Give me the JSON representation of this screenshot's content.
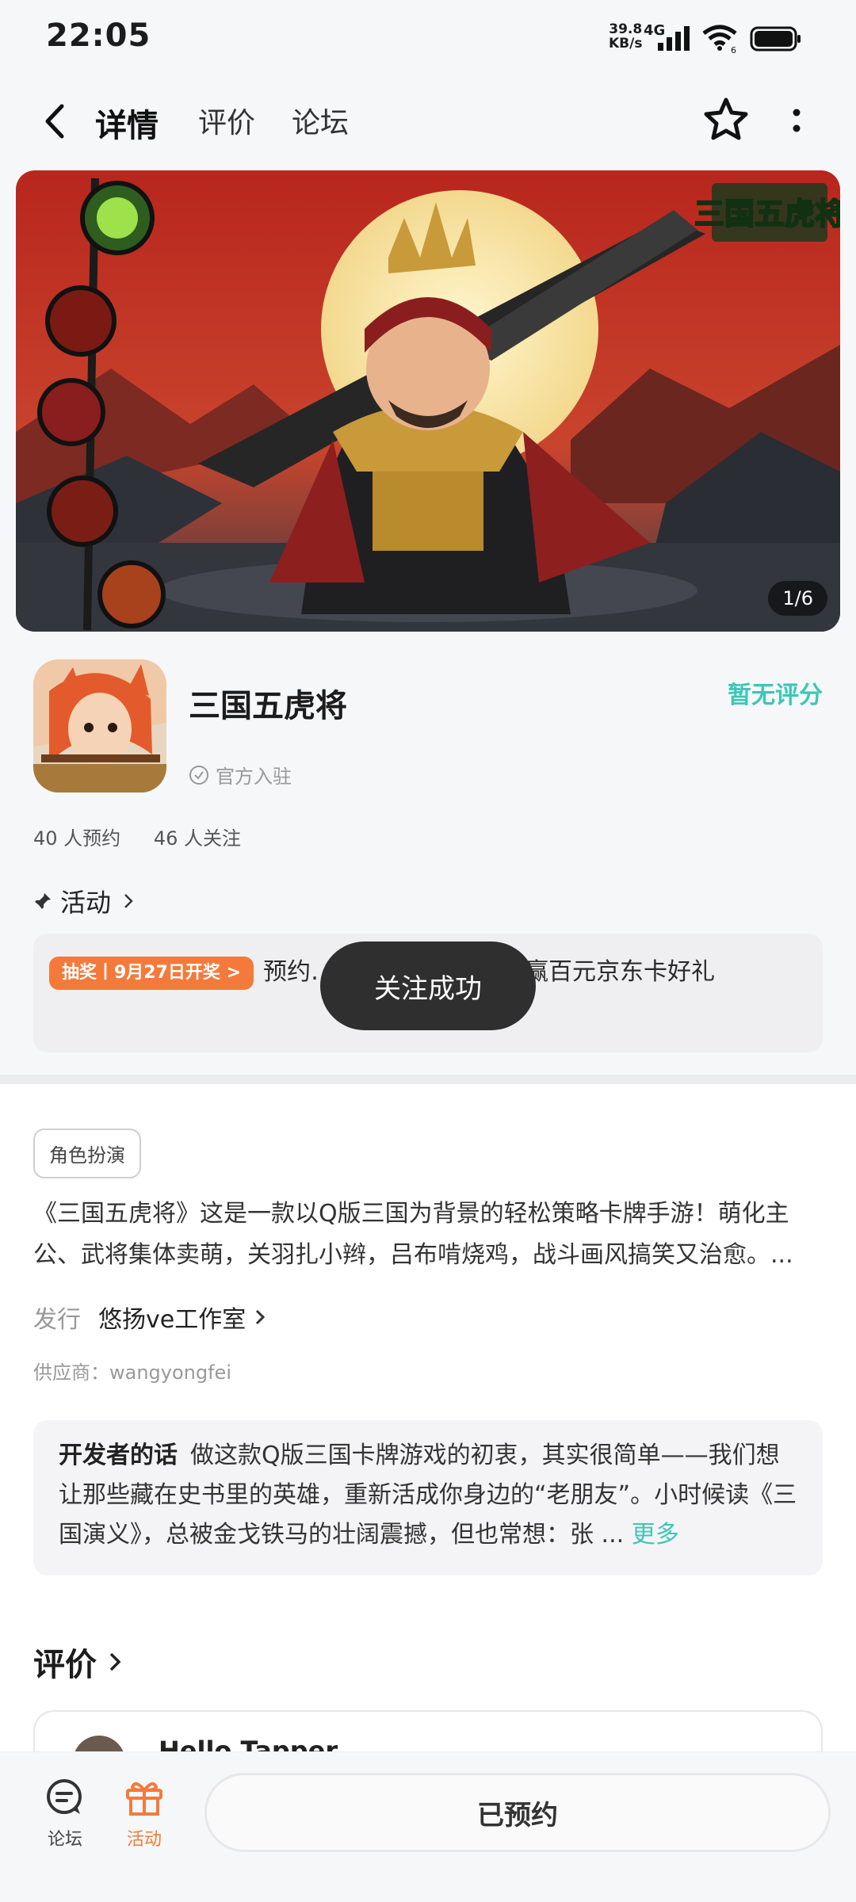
{
  "status_bar": {
    "time": "22:05",
    "net_speed_value": "39.8",
    "net_speed_unit": "KB/s",
    "network": "4G",
    "wifi_badge": "6"
  },
  "nav": {
    "tabs": [
      "详情",
      "评价",
      "论坛"
    ]
  },
  "banner": {
    "title_art": "三国五虎将",
    "counter": "1/6"
  },
  "game": {
    "title": "三国五虎将",
    "verified_label": "官方入驻",
    "rating_label": "暂无评分",
    "reservations": "40 人预约",
    "followers": "46 人关注"
  },
  "activity": {
    "header": "活动",
    "badge": "抽奖丨9月27日开奖 >",
    "text": "预约…【预约好礼】预约赢百元京东卡好礼"
  },
  "toast": {
    "message": "关注成功"
  },
  "details": {
    "tag": "角色扮演",
    "description": "《三国五虎将》这是一款以Q版三国为背景的轻松策略卡牌手游！萌化主公、武将集体卖萌，关羽扎小辫，吕布啃烧鸡，战斗画风搞笑又治愈。...",
    "publisher_label": "发行",
    "publisher_name": "悠扬ve工作室",
    "supplier": "供应商：wangyongfei"
  },
  "developer": {
    "label": "开发者的话",
    "text": "做这款Q版三国卡牌游戏的初衷，其实很简单——我们想让那些藏在史书里的英雄，重新活成你身边的“老朋友”。小时候读《三国演义》，总被金戈铁马的壮阔震撼，但也常想：张 ...",
    "more": "更多"
  },
  "reviews": {
    "header": "评价",
    "first_user": "Hello Tapper"
  },
  "bottom_bar": {
    "forum_label": "论坛",
    "activity_label": "活动",
    "reserve_button": "已预约"
  },
  "colors": {
    "accent_teal": "#3ec6b5",
    "accent_orange": "#f47a3b",
    "toast_bg": "#2f2f2f"
  }
}
